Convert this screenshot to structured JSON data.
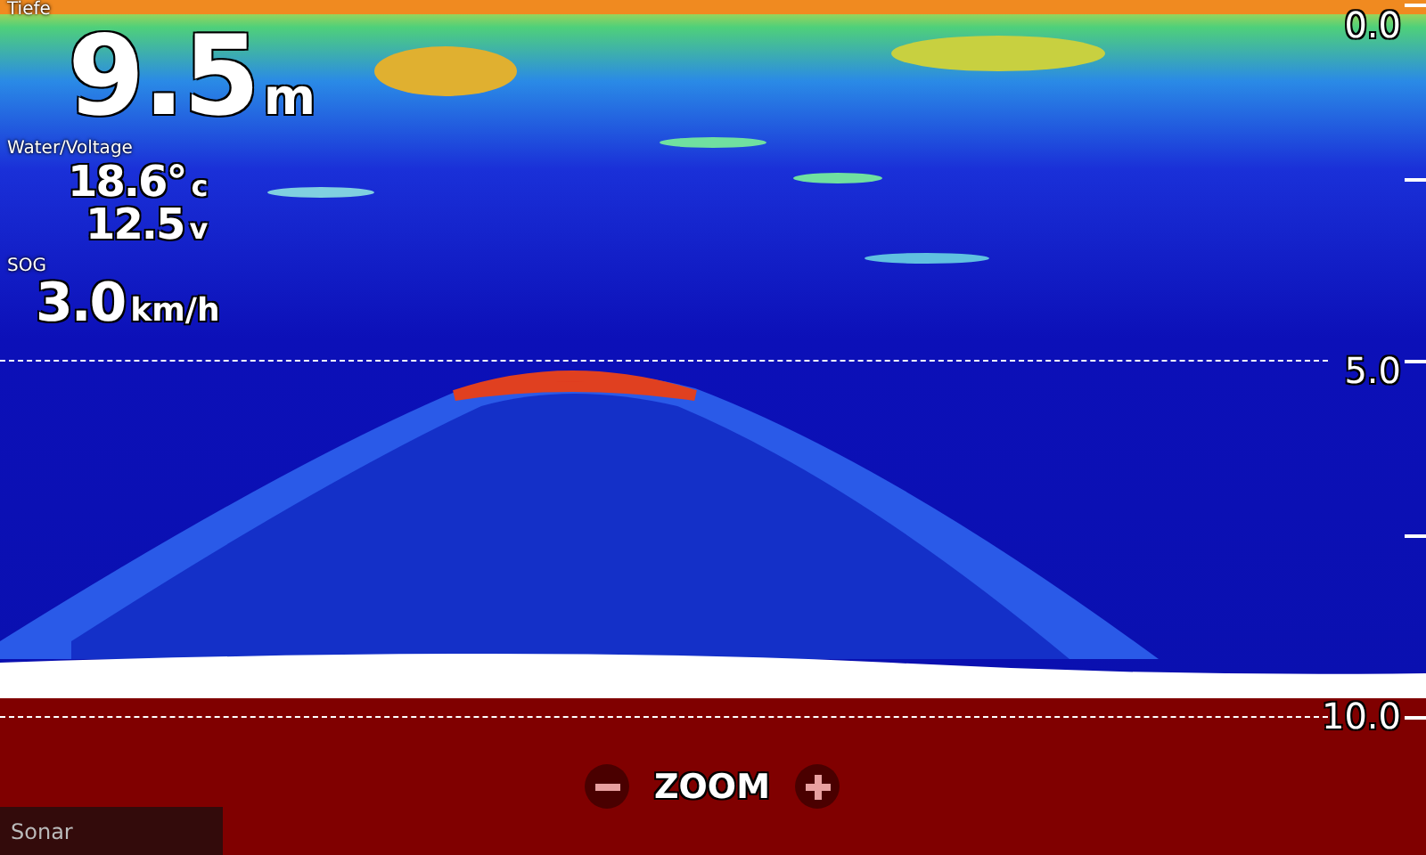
{
  "readouts": [
    {
      "label": "Tiefe",
      "kind": "large",
      "values": [
        {
          "value": "9.5",
          "unit": "m"
        }
      ]
    },
    {
      "label": "Water/Voltage",
      "kind": "medium",
      "values": [
        {
          "value": "18.6°",
          "unit": "c"
        },
        {
          "value": "12.5",
          "unit": "v"
        }
      ]
    },
    {
      "label": "SOG",
      "kind": "speed",
      "values": [
        {
          "value": "3.0",
          "unit": "km/h"
        }
      ]
    }
  ],
  "depth_scale": [
    "0.0",
    "5.0",
    "10.0"
  ],
  "zoom": {
    "label": "ZOOM"
  },
  "footer": {
    "title": "Sonar"
  }
}
